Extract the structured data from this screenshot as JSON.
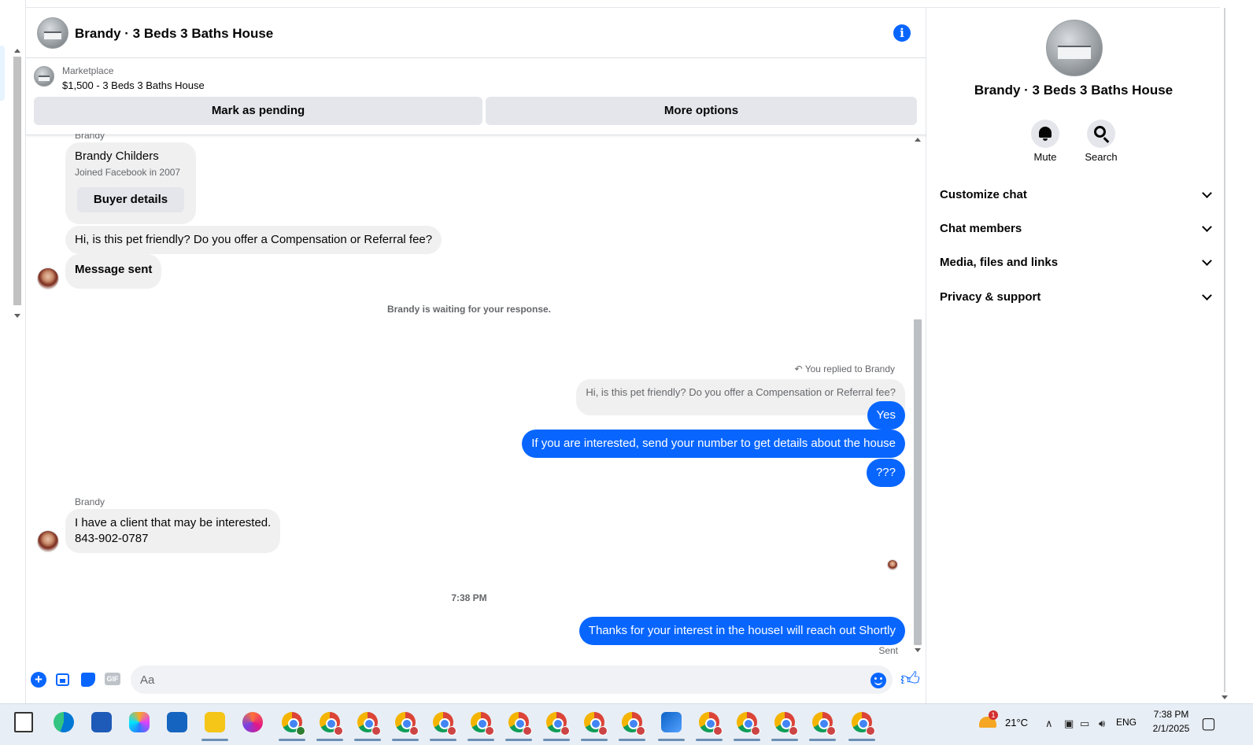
{
  "chat": {
    "title": "Brandy · 3 Beds 3 Baths House",
    "marketplace_label": "Marketplace",
    "listing": "$1,500 - 3 Beds 3 Baths House",
    "mark_pending_label": "Mark as pending",
    "more_options_label": "More options"
  },
  "messages": {
    "top_name": "Brandy",
    "buyer_card": {
      "name": "Brandy Childers",
      "joined": "Joined Facebook in 2007",
      "button": "Buyer details"
    },
    "incoming_1": "Hi, is this pet friendly? Do you offer a Compensation or Referral fee?",
    "incoming_2": "Message sent",
    "waiting_note": "Brandy is waiting for your response.",
    "reply_note": "You replied to Brandy",
    "reply_quote": "Hi, is this pet friendly? Do you offer a Compensation or Referral fee?",
    "out_1": "Yes",
    "out_2": "If you are interested, send your number to get details about the house",
    "out_3": "???",
    "sender_name": "Brandy",
    "incoming_3_line1": "I have a client that may be interested.",
    "incoming_3_line2": "843-902-0787",
    "timestamp": "7:38 PM",
    "out_4": "Thanks for your interest in the houseI will reach out Shortly",
    "status": "Sent"
  },
  "composer": {
    "placeholder": "Aa",
    "gif_label": "GIF"
  },
  "right_panel": {
    "title": "Brandy · 3 Beds 3 Baths House",
    "mute_label": "Mute",
    "search_label": "Search",
    "sections": [
      "Customize chat",
      "Chat members",
      "Media, files and links",
      "Privacy & support"
    ]
  },
  "taskbar": {
    "temperature": "21°C",
    "weather_badge": "1",
    "language": "ENG",
    "time": "7:38 PM",
    "date": "2/1/2025"
  },
  "colors": {
    "accent": "#0866ff",
    "bubble_gray": "#f0f0f0",
    "button_gray": "#e4e6eb"
  }
}
